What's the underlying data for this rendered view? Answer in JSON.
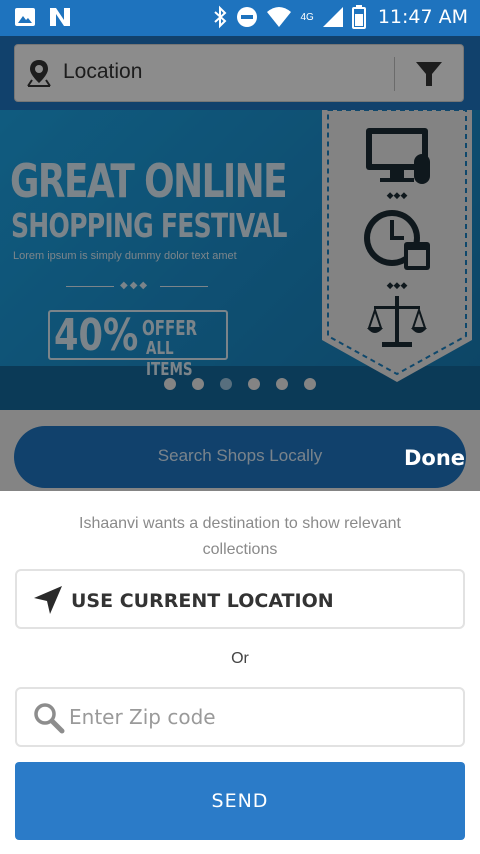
{
  "status_bar": {
    "time": "11:47 AM",
    "network_label": "4G",
    "icons": [
      "image-icon",
      "n-app-icon",
      "bluetooth-icon",
      "do-not-disturb-icon",
      "wifi-icon",
      "cell-signal-icon",
      "battery-icon"
    ]
  },
  "app": {
    "location_bar": {
      "label": "Location",
      "icons": [
        "location-pin-icon",
        "filter-icon"
      ]
    },
    "banner": {
      "title_line1": "GREAT ONLINE",
      "title_line2": "SHOPPING FESTIVAL",
      "subtitle": "Lorem ipsum is simply dummy dolor text amet",
      "offer_percent": "40%",
      "offer_word": "OFFER",
      "offer_items": "ALL ITEMS",
      "ribbon_icons": [
        "monitor-icon",
        "clock-calendar-icon",
        "scales-icon"
      ],
      "slide_count": 6,
      "active_slide_index": 2
    },
    "search_shops_label": "Search Shops Locally"
  },
  "dialog": {
    "done_label": "Done",
    "prompt": "Ishaanvi wants a destination to show relevant collections",
    "use_current_location_label": "USE CURRENT LOCATION",
    "or_label": "Or",
    "zip_placeholder": "Enter Zip code",
    "zip_value": "",
    "send_label": "SEND"
  },
  "colors": {
    "primary": "#1e73be",
    "send_button": "#2b7bc8",
    "prompt_text": "#8a8a8a",
    "field_border": "#e2e2e2"
  }
}
